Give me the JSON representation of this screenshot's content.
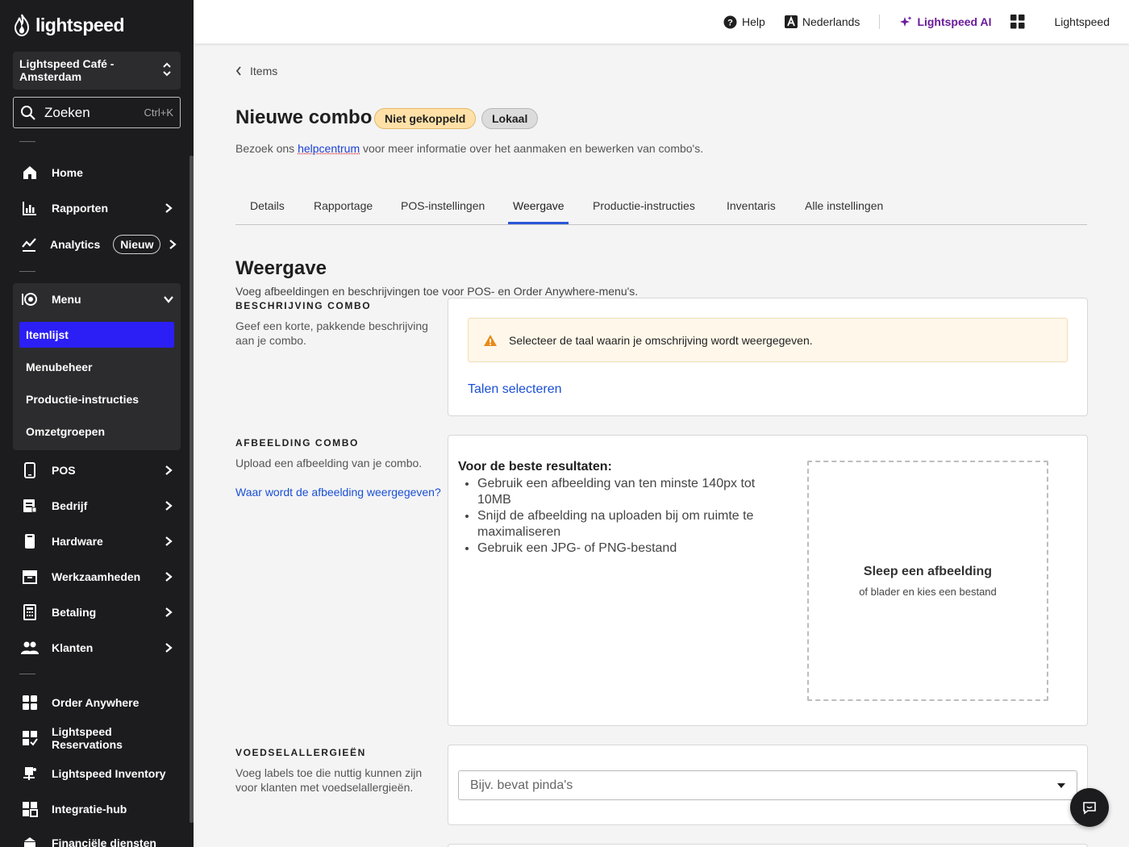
{
  "brand": {
    "name": "lightspeed"
  },
  "sidebar": {
    "venue": "Lightspeed Café - Amsterdam",
    "search": {
      "label": "Zoeken",
      "shortcut": "Ctrl+K"
    },
    "items": [
      {
        "label": "Home",
        "icon": "home-icon"
      },
      {
        "label": "Rapporten",
        "icon": "bar-chart-icon"
      },
      {
        "label": "Analytics",
        "icon": "trend-icon",
        "badge": "Nieuw"
      },
      {
        "label": "Menu",
        "icon": "menu-book-icon"
      },
      {
        "label": "POS",
        "icon": "tablet-icon"
      },
      {
        "label": "Bedrijf",
        "icon": "company-icon"
      },
      {
        "label": "Hardware",
        "icon": "device-icon"
      },
      {
        "label": "Werkzaamheden",
        "icon": "archive-icon"
      },
      {
        "label": "Betaling",
        "icon": "calculator-icon"
      },
      {
        "label": "Klanten",
        "icon": "customers-icon"
      },
      {
        "label": "Order Anywhere",
        "icon": "order-icon"
      },
      {
        "label": "Lightspeed Reservations",
        "icon": "reservations-icon"
      },
      {
        "label": "Lightspeed Inventory",
        "icon": "inventory-icon"
      },
      {
        "label": "Integratie-hub",
        "icon": "integrations-icon"
      },
      {
        "label": "Financiële diensten",
        "icon": "finance-icon"
      }
    ],
    "menu_sub": [
      "Itemlijst",
      "Menubeheer",
      "Productie-instructies",
      "Omzetgroepen"
    ]
  },
  "topbar": {
    "help": "Help",
    "language": "Nederlands",
    "ai": "Lightspeed AI",
    "account": "Lightspeed"
  },
  "page": {
    "back": "Items",
    "title": "Nieuwe combo",
    "badge_status": "Niet gekoppeld",
    "badge_scope": "Lokaal",
    "subtitle_pre": "Bezoek ons ",
    "subtitle_link": "helpcentrum",
    "subtitle_post": " voor meer informatie over het aanmaken en bewerken van combo's.",
    "tabs": [
      "Details",
      "Rapportage",
      "POS-instellingen",
      "Weergave",
      "Productie-instructies",
      "Inventaris",
      "Alle instellingen"
    ],
    "active_tab": "Weergave"
  },
  "section": {
    "title": "Weergave",
    "subtitle": "Voeg afbeeldingen en beschrijvingen toe voor POS- en Order Anywhere-menu's."
  },
  "description_block": {
    "title": "BESCHRIJVING COMBO",
    "desc": "Geef een korte, pakkende beschrijving aan je combo.",
    "notice": "Selecteer de taal waarin je omschrijving wordt weergegeven.",
    "link": "Talen selecteren"
  },
  "image_block": {
    "title": "AFBEELDING COMBO",
    "desc": "Upload een afbeelding van je combo.",
    "link": "Waar wordt de afbeelding weergegeven?",
    "tips_title": "Voor de beste resultaten:",
    "tips": [
      "Gebruik een afbeelding van ten minste 140px tot 10MB",
      "Snijd de afbeelding na uploaden bij om ruimte te maximaliseren",
      "Gebruik een JPG- of PNG-bestand"
    ],
    "drop_title": "Sleep een afbeelding",
    "drop_sub": "of blader en kies een bestand"
  },
  "allergen_block": {
    "title": "VOEDSELALLERGIEËN",
    "desc": "Voeg labels toe die nuttig kunnen zijn voor klanten met voedselallergieën.",
    "placeholder": "Bijv. bevat pinda's"
  }
}
